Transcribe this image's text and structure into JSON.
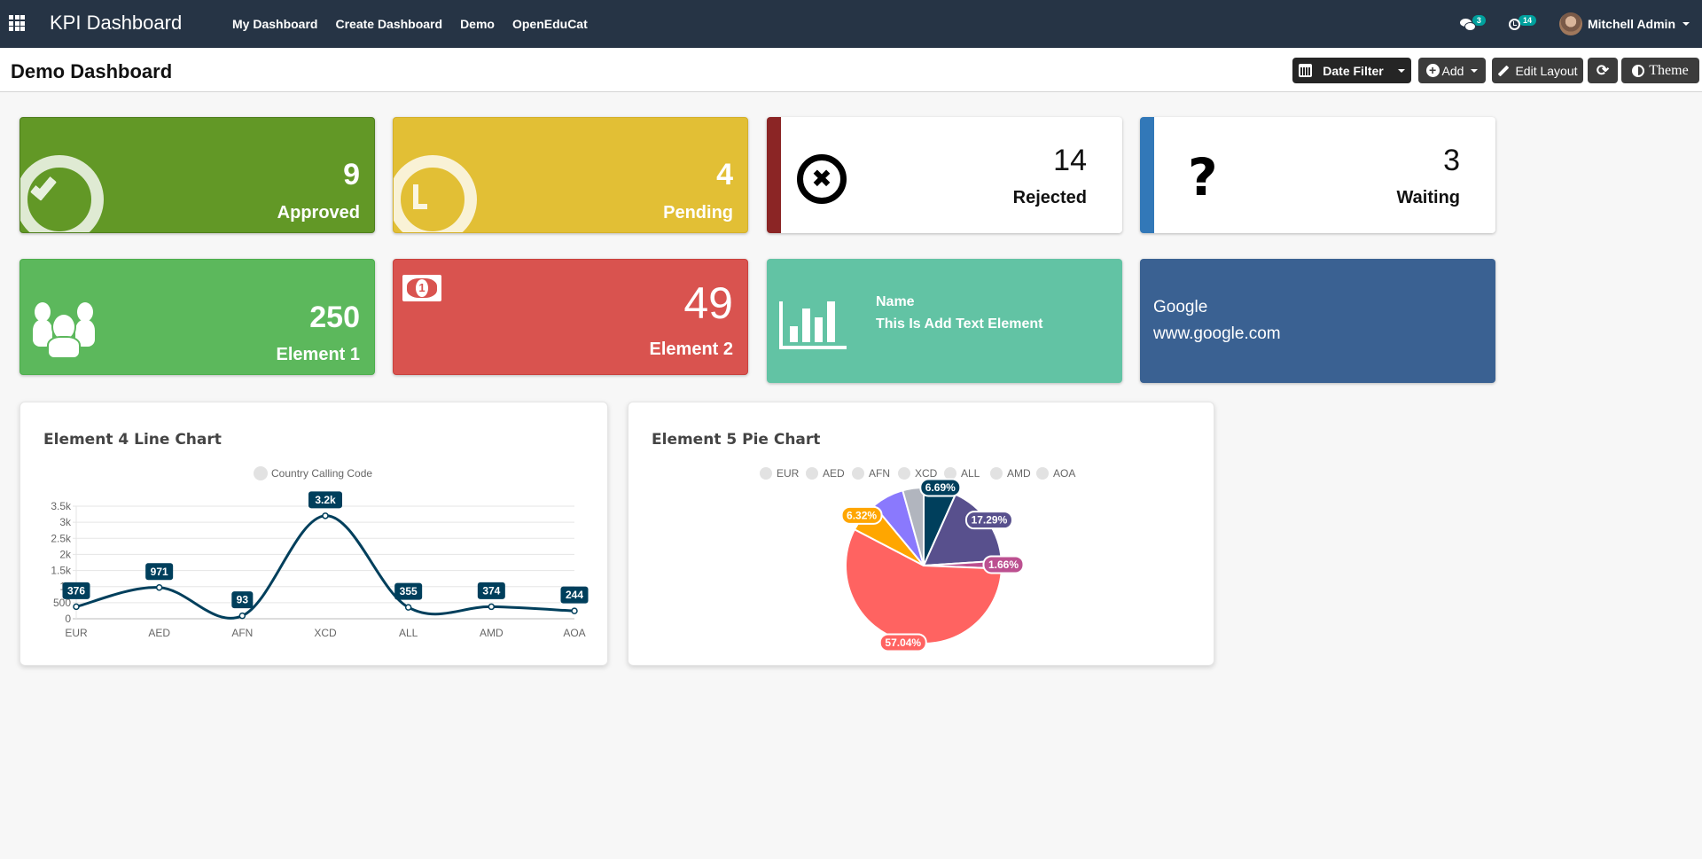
{
  "navbar": {
    "brand": "KPI Dashboard",
    "menu": [
      "My Dashboard",
      "Create Dashboard",
      "Demo",
      "OpenEduCat"
    ],
    "messages_count": "3",
    "activities_count": "14",
    "user_name": "Mitchell Admin"
  },
  "control_bar": {
    "title": "Demo Dashboard",
    "date_filter_label": "Date Filter",
    "add_label": "Add",
    "edit_layout_label": "Edit Layout",
    "theme_label": "Theme"
  },
  "tiles": {
    "approved": {
      "value": "9",
      "label": "Approved",
      "color": "#629826"
    },
    "pending": {
      "value": "4",
      "label": "Pending",
      "color": "#e2bf35"
    },
    "rejected": {
      "value": "14",
      "label": "Rejected",
      "accent": "#8b2525"
    },
    "waiting": {
      "value": "3",
      "label": "Waiting",
      "accent": "#3278b8"
    },
    "element1": {
      "value": "250",
      "label": "Element 1",
      "color": "#5cb85c"
    },
    "element2": {
      "value": "49",
      "label": "Element 2",
      "color": "#d9534f"
    },
    "text_element": {
      "name": "Name",
      "text": "This Is Add Text Element",
      "color": "#62c3a4"
    },
    "link_element": {
      "name": "Google",
      "url": "www.google.com",
      "color": "#3a6192"
    }
  },
  "chart_data": [
    {
      "type": "line",
      "title": "Element 4 Line Chart",
      "legend": [
        "Country Calling Code"
      ],
      "legend_position": "top",
      "categories": [
        "EUR",
        "AED",
        "AFN",
        "XCD",
        "ALL",
        "AMD",
        "AOA"
      ],
      "series": [
        {
          "name": "Country Calling Code",
          "values": [
            376,
            971,
            93,
            3202,
            355,
            374,
            244
          ],
          "color": "#003f5c"
        }
      ],
      "data_labels": [
        "376",
        "971",
        "93",
        "3.2k",
        "355",
        "374",
        "244"
      ],
      "yticks": [
        "0",
        "500",
        "1k",
        "1.5k",
        "2k",
        "2.5k",
        "3k",
        "3.5k"
      ],
      "ylim": [
        0,
        3500
      ],
      "grid": true,
      "xlabel": "",
      "ylabel": ""
    },
    {
      "type": "pie",
      "title": "Element 5 Pie Chart",
      "legend": [
        "EUR",
        "AED",
        "AFN",
        "XCD",
        "ALL",
        "AMD",
        "AOA"
      ],
      "legend_position": "top",
      "categories": [
        "EUR",
        "AED",
        "AFN",
        "XCD",
        "ALL",
        "AMD",
        "AOA"
      ],
      "values": [
        376,
        971,
        93,
        3202,
        355,
        374,
        244
      ],
      "percent_labels": [
        "6.69%",
        "17.29%",
        "1.66%",
        "57.04%",
        "6.32%",
        "",
        ""
      ],
      "colors": [
        "#003f5c",
        "#58508d",
        "#bc5090",
        "#ff6361",
        "#ffa600",
        "#8a79fd",
        "#b1b5be"
      ]
    }
  ]
}
